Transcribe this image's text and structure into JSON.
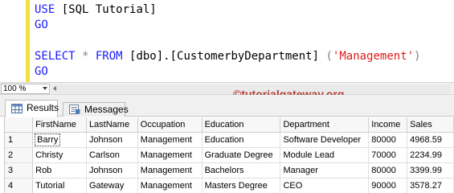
{
  "editor": {
    "lines": [
      {
        "kw1": "USE",
        "rest": " [SQL Tutorial]"
      },
      {
        "kw1": "GO"
      },
      {
        "kw1": "SELECT",
        "op": " * ",
        "kw2": "FROM",
        "obj": " [dbo].[CustomerbyDepartment] ",
        "lp": "(",
        "str": "'Management'",
        "rp": ")"
      },
      {
        "kw1": "GO"
      }
    ]
  },
  "zoom": {
    "value": "100 %"
  },
  "watermark": "©tutorialgateway.org",
  "tabs": {
    "results": "Results",
    "messages": "Messages"
  },
  "colors": {
    "keyword": "#1a1aff",
    "string": "#e01b1b",
    "change_bar": "#f2e23c",
    "watermark": "#b0413a"
  },
  "grid": {
    "columns": [
      "FirstName",
      "LastName",
      "Occupation",
      "Education",
      "Department",
      "Income",
      "Sales"
    ],
    "rows": [
      {
        "n": "1",
        "cells": [
          "Barry",
          "Johnson",
          "Management",
          "Education",
          "Software Developer",
          "80000",
          "4968.59"
        ]
      },
      {
        "n": "2",
        "cells": [
          "Christy",
          "Carlson",
          "Management",
          "Graduate Degree",
          "Module Lead",
          "70000",
          "2234.99"
        ]
      },
      {
        "n": "3",
        "cells": [
          "Rob",
          "Johnson",
          "Management",
          "Bachelors",
          "Manager",
          "80000",
          "3399.99"
        ]
      },
      {
        "n": "4",
        "cells": [
          "Tutorial",
          "Gateway",
          "Management",
          "Masters Degree",
          "CEO",
          "90000",
          "3578.27"
        ]
      }
    ]
  }
}
